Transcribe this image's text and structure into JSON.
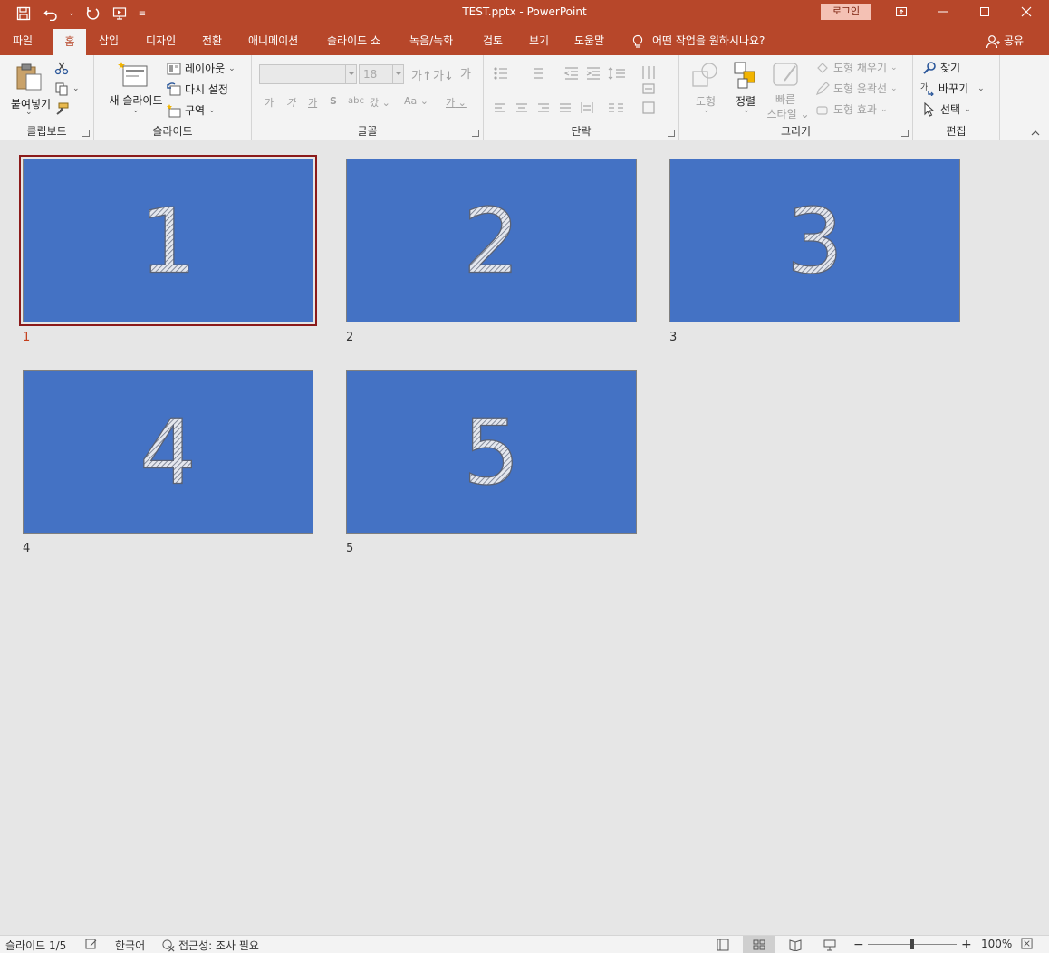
{
  "window": {
    "title": "TEST.pptx  -  PowerPoint",
    "login_label": "로그인"
  },
  "colors": {
    "accent": "#b7472a",
    "slide_fill": "#4472c4",
    "selected_border": "#8b1a1a",
    "ribbon_bg": "#f3f3f3",
    "canvas_bg": "#e6e6e6"
  },
  "tabs": [
    "파일",
    "홈",
    "삽입",
    "디자인",
    "전환",
    "애니메이션",
    "슬라이드 쇼",
    "녹음/녹화",
    "검토",
    "보기",
    "도움말"
  ],
  "active_tab": "홈",
  "tell_me": "어떤 작업을 원하시나요?",
  "share": "공유",
  "ribbon": {
    "clipboard": {
      "label": "클립보드",
      "paste": "붙여넣기"
    },
    "slides": {
      "label": "슬라이드",
      "new_slide_1": "새",
      "new_slide_2": "슬라이드",
      "layout": "레이아웃",
      "reset": "다시 설정",
      "section": "구역"
    },
    "font": {
      "label": "글꼴",
      "size": "18",
      "small_a": "가",
      "clear": "가",
      "bold": "가",
      "italic": "가",
      "underline": "가",
      "shadow": "S",
      "strike": "abc",
      "spacing": "갔",
      "case": "Aa",
      "color": "가"
    },
    "paragraph": {
      "label": "단락"
    },
    "drawing": {
      "label": "그리기",
      "shapes": "도형",
      "arrange": "정렬",
      "quick_styles_1": "빠른",
      "quick_styles_2": "스타일",
      "fill": "도형 채우기",
      "outline": "도형 윤곽선",
      "effects": "도형 효과"
    },
    "editing": {
      "label": "편집",
      "find": "찾기",
      "replace": "바꾸기",
      "select": "선택"
    }
  },
  "slides": [
    {
      "number": "1",
      "label": "1",
      "selected": true
    },
    {
      "number": "2",
      "label": "2",
      "selected": false
    },
    {
      "number": "3",
      "label": "3",
      "selected": false
    },
    {
      "number": "4",
      "label": "4",
      "selected": false
    },
    {
      "number": "5",
      "label": "5",
      "selected": false
    }
  ],
  "status": {
    "slide_count": "슬라이드 1/5",
    "language": "한국어",
    "accessibility": "접근성: 조사 필요",
    "zoom": "100%",
    "zoom_fraction": 0.5
  }
}
